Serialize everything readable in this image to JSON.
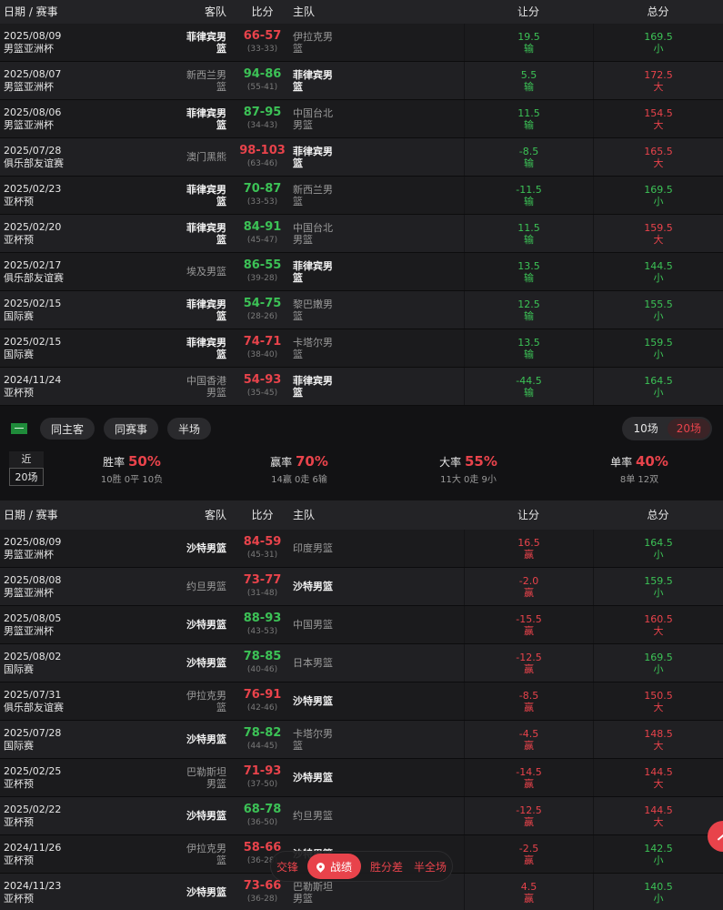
{
  "header": {
    "date": "日期 / 赛事",
    "away": "客队",
    "score": "比分",
    "home": "主队",
    "handicap": "让分",
    "total": "总分"
  },
  "table1": [
    {
      "date": "2025/08/09",
      "event": "男篮亚洲杯",
      "away": "菲律宾男篮",
      "away_bold": true,
      "score": "66-57",
      "score_color": "red",
      "half": "(33-33)",
      "home": "伊拉克男篮",
      "home_bold": false,
      "hcp": "19.5",
      "hcp_res": "输",
      "hcp_color": "green",
      "tot": "169.5",
      "tot_res": "小",
      "tot_color": "green"
    },
    {
      "date": "2025/08/07",
      "event": "男篮亚洲杯",
      "away": "新西兰男篮",
      "away_bold": false,
      "score": "94-86",
      "score_color": "green",
      "half": "(55-41)",
      "home": "菲律宾男篮",
      "home_bold": true,
      "hcp": "5.5",
      "hcp_res": "输",
      "hcp_color": "green",
      "tot": "172.5",
      "tot_res": "大",
      "tot_color": "red"
    },
    {
      "date": "2025/08/06",
      "event": "男篮亚洲杯",
      "away": "菲律宾男篮",
      "away_bold": true,
      "score": "87-95",
      "score_color": "green",
      "half": "(34-43)",
      "home": "中国台北男篮",
      "home_bold": false,
      "hcp": "11.5",
      "hcp_res": "输",
      "hcp_color": "green",
      "tot": "154.5",
      "tot_res": "大",
      "tot_color": "red"
    },
    {
      "date": "2025/07/28",
      "event": "俱乐部友谊赛",
      "away": "澳门黑熊",
      "away_bold": false,
      "score": "98-103",
      "score_color": "red",
      "half": "(63-46)",
      "home": "菲律宾男篮",
      "home_bold": true,
      "hcp": "-8.5",
      "hcp_res": "输",
      "hcp_color": "green",
      "tot": "165.5",
      "tot_res": "大",
      "tot_color": "red"
    },
    {
      "date": "2025/02/23",
      "event": "亚杯预",
      "away": "菲律宾男篮",
      "away_bold": true,
      "score": "70-87",
      "score_color": "green",
      "half": "(33-53)",
      "home": "新西兰男篮",
      "home_bold": false,
      "hcp": "-11.5",
      "hcp_res": "输",
      "hcp_color": "green",
      "tot": "169.5",
      "tot_res": "小",
      "tot_color": "green"
    },
    {
      "date": "2025/02/20",
      "event": "亚杯预",
      "away": "菲律宾男篮",
      "away_bold": true,
      "score": "84-91",
      "score_color": "green",
      "half": "(45-47)",
      "home": "中国台北男篮",
      "home_bold": false,
      "hcp": "11.5",
      "hcp_res": "输",
      "hcp_color": "green",
      "tot": "159.5",
      "tot_res": "大",
      "tot_color": "red"
    },
    {
      "date": "2025/02/17",
      "event": "俱乐部友谊赛",
      "away": "埃及男篮",
      "away_bold": false,
      "score": "86-55",
      "score_color": "green",
      "half": "(39-28)",
      "home": "菲律宾男篮",
      "home_bold": true,
      "hcp": "13.5",
      "hcp_res": "输",
      "hcp_color": "green",
      "tot": "144.5",
      "tot_res": "小",
      "tot_color": "green"
    },
    {
      "date": "2025/02/15",
      "event": "国际赛",
      "away": "菲律宾男篮",
      "away_bold": true,
      "score": "54-75",
      "score_color": "green",
      "half": "(28-26)",
      "home": "黎巴嫩男篮",
      "home_bold": false,
      "hcp": "12.5",
      "hcp_res": "输",
      "hcp_color": "green",
      "tot": "155.5",
      "tot_res": "小",
      "tot_color": "green"
    },
    {
      "date": "2025/02/15",
      "event": "国际赛",
      "away": "菲律宾男篮",
      "away_bold": true,
      "score": "74-71",
      "score_color": "red",
      "half": "(38-40)",
      "home": "卡塔尔男篮",
      "home_bold": false,
      "hcp": "13.5",
      "hcp_res": "输",
      "hcp_color": "green",
      "tot": "159.5",
      "tot_res": "小",
      "tot_color": "green"
    },
    {
      "date": "2024/11/24",
      "event": "亚杯预",
      "away": "中国香港男篮",
      "away_bold": false,
      "score": "54-93",
      "score_color": "red",
      "half": "(35-45)",
      "home": "菲律宾男篮",
      "home_bold": true,
      "hcp": "-44.5",
      "hcp_res": "输",
      "hcp_color": "green",
      "tot": "164.5",
      "tot_res": "小",
      "tot_color": "green"
    }
  ],
  "filters": {
    "b1": "同主客",
    "b2": "同赛事",
    "b3": "半场",
    "t10": "10场",
    "t20": "20场"
  },
  "stats": {
    "recent_label": "近",
    "recent_value": "20场",
    "win_label": "胜率",
    "win_val": "50%",
    "win_sub": "10胜 0平 10负",
    "cover_label": "赢率",
    "cover_val": "70%",
    "cover_sub": "14赢 0走 6输",
    "over_label": "大率",
    "over_val": "55%",
    "over_sub": "11大 0走 9小",
    "odd_label": "单率",
    "odd_val": "40%",
    "odd_sub": "8单 12双"
  },
  "table2": [
    {
      "date": "2025/08/09",
      "event": "男篮亚洲杯",
      "away": "沙特男篮",
      "away_bold": true,
      "score": "84-59",
      "score_color": "red",
      "half": "(45-31)",
      "home": "印度男篮",
      "home_bold": false,
      "hcp": "16.5",
      "hcp_res": "赢",
      "hcp_color": "red",
      "tot": "164.5",
      "tot_res": "小",
      "tot_color": "green"
    },
    {
      "date": "2025/08/08",
      "event": "男篮亚洲杯",
      "away": "约旦男篮",
      "away_bold": false,
      "score": "73-77",
      "score_color": "red",
      "half": "(31-48)",
      "home": "沙特男篮",
      "home_bold": true,
      "hcp": "-2.0",
      "hcp_res": "赢",
      "hcp_color": "red",
      "tot": "159.5",
      "tot_res": "小",
      "tot_color": "green"
    },
    {
      "date": "2025/08/05",
      "event": "男篮亚洲杯",
      "away": "沙特男篮",
      "away_bold": true,
      "score": "88-93",
      "score_color": "green",
      "half": "(43-53)",
      "home": "中国男篮",
      "home_bold": false,
      "hcp": "-15.5",
      "hcp_res": "赢",
      "hcp_color": "red",
      "tot": "160.5",
      "tot_res": "大",
      "tot_color": "red"
    },
    {
      "date": "2025/08/02",
      "event": "国际赛",
      "away": "沙特男篮",
      "away_bold": true,
      "score": "78-85",
      "score_color": "green",
      "half": "(40-46)",
      "home": "日本男篮",
      "home_bold": false,
      "hcp": "-12.5",
      "hcp_res": "赢",
      "hcp_color": "red",
      "tot": "169.5",
      "tot_res": "小",
      "tot_color": "green"
    },
    {
      "date": "2025/07/31",
      "event": "俱乐部友谊赛",
      "away": "伊拉克男篮",
      "away_bold": false,
      "score": "76-91",
      "score_color": "red",
      "half": "(42-46)",
      "home": "沙特男篮",
      "home_bold": true,
      "hcp": "-8.5",
      "hcp_res": "赢",
      "hcp_color": "red",
      "tot": "150.5",
      "tot_res": "大",
      "tot_color": "red"
    },
    {
      "date": "2025/07/28",
      "event": "国际赛",
      "away": "沙特男篮",
      "away_bold": true,
      "score": "78-82",
      "score_color": "green",
      "half": "(44-45)",
      "home": "卡塔尔男篮",
      "home_bold": false,
      "hcp": "-4.5",
      "hcp_res": "赢",
      "hcp_color": "red",
      "tot": "148.5",
      "tot_res": "大",
      "tot_color": "red"
    },
    {
      "date": "2025/02/25",
      "event": "亚杯预",
      "away": "巴勒斯坦男篮",
      "away_bold": false,
      "score": "71-93",
      "score_color": "red",
      "half": "(37-50)",
      "home": "沙特男篮",
      "home_bold": true,
      "hcp": "-14.5",
      "hcp_res": "赢",
      "hcp_color": "red",
      "tot": "144.5",
      "tot_res": "大",
      "tot_color": "red"
    },
    {
      "date": "2025/02/22",
      "event": "亚杯预",
      "away": "沙特男篮",
      "away_bold": true,
      "score": "68-78",
      "score_color": "green",
      "half": "(36-50)",
      "home": "约旦男篮",
      "home_bold": false,
      "hcp": "-12.5",
      "hcp_res": "赢",
      "hcp_color": "red",
      "tot": "144.5",
      "tot_res": "大",
      "tot_color": "red"
    },
    {
      "date": "2024/11/26",
      "event": "亚杯预",
      "away": "伊拉克男篮",
      "away_bold": false,
      "score": "58-66",
      "score_color": "red",
      "half": "(36-28)",
      "home": "沙特男篮",
      "home_bold": true,
      "hcp": "-2.5",
      "hcp_res": "赢",
      "hcp_color": "red",
      "tot": "142.5",
      "tot_res": "小",
      "tot_color": "green"
    },
    {
      "date": "2024/11/23",
      "event": "亚杯预",
      "away": "沙特男篮",
      "away_bold": true,
      "score": "73-66",
      "score_color": "red",
      "half": "(36-28)",
      "home": "巴勒斯坦男篮",
      "home_bold": false,
      "hcp": "4.5",
      "hcp_res": "赢",
      "hcp_color": "red",
      "tot": "140.5",
      "tot_res": "小",
      "tot_color": "green"
    }
  ],
  "bottom_nav": {
    "n1": "交锋",
    "n2": "战绩",
    "n3": "胜分差",
    "n4": "半全场"
  },
  "colors": {
    "red": "#e8434b",
    "green": "#3cc256",
    "bg": "#121214"
  }
}
